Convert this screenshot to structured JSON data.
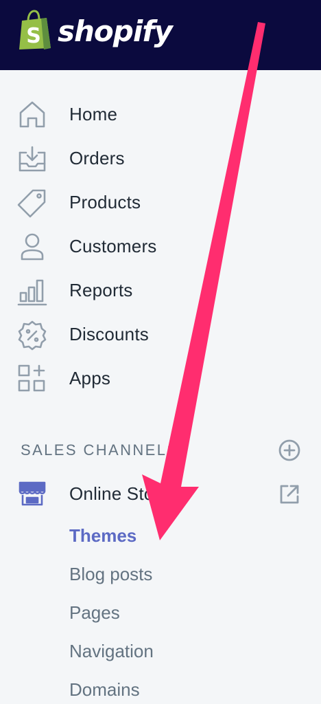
{
  "brand": {
    "name": "shopify",
    "icon": "shopify-bag-logo",
    "topbar_color": "#0b0a3e",
    "logo_green": "#95bf47"
  },
  "nav": {
    "items": [
      {
        "label": "Home",
        "icon": "home-icon"
      },
      {
        "label": "Orders",
        "icon": "orders-inbox-icon"
      },
      {
        "label": "Products",
        "icon": "tag-icon"
      },
      {
        "label": "Customers",
        "icon": "person-icon"
      },
      {
        "label": "Reports",
        "icon": "bar-chart-icon"
      },
      {
        "label": "Discounts",
        "icon": "discount-badge-icon"
      },
      {
        "label": "Apps",
        "icon": "apps-grid-icon"
      }
    ]
  },
  "sales_channels": {
    "title": "SALES CHANNELS",
    "add_icon": "plus-circle-icon",
    "channel": {
      "label": "Online Store",
      "icon": "storefront-icon",
      "external_icon": "external-link-icon"
    },
    "sub_items": [
      {
        "label": "Themes",
        "active": true
      },
      {
        "label": "Blog posts",
        "active": false
      },
      {
        "label": "Pages",
        "active": false
      },
      {
        "label": "Navigation",
        "active": false
      },
      {
        "label": "Domains",
        "active": false
      }
    ]
  },
  "colors": {
    "active_link": "#5c6ac4",
    "annotation_arrow": "#ff2d6f",
    "icon_gray": "#919eab"
  }
}
